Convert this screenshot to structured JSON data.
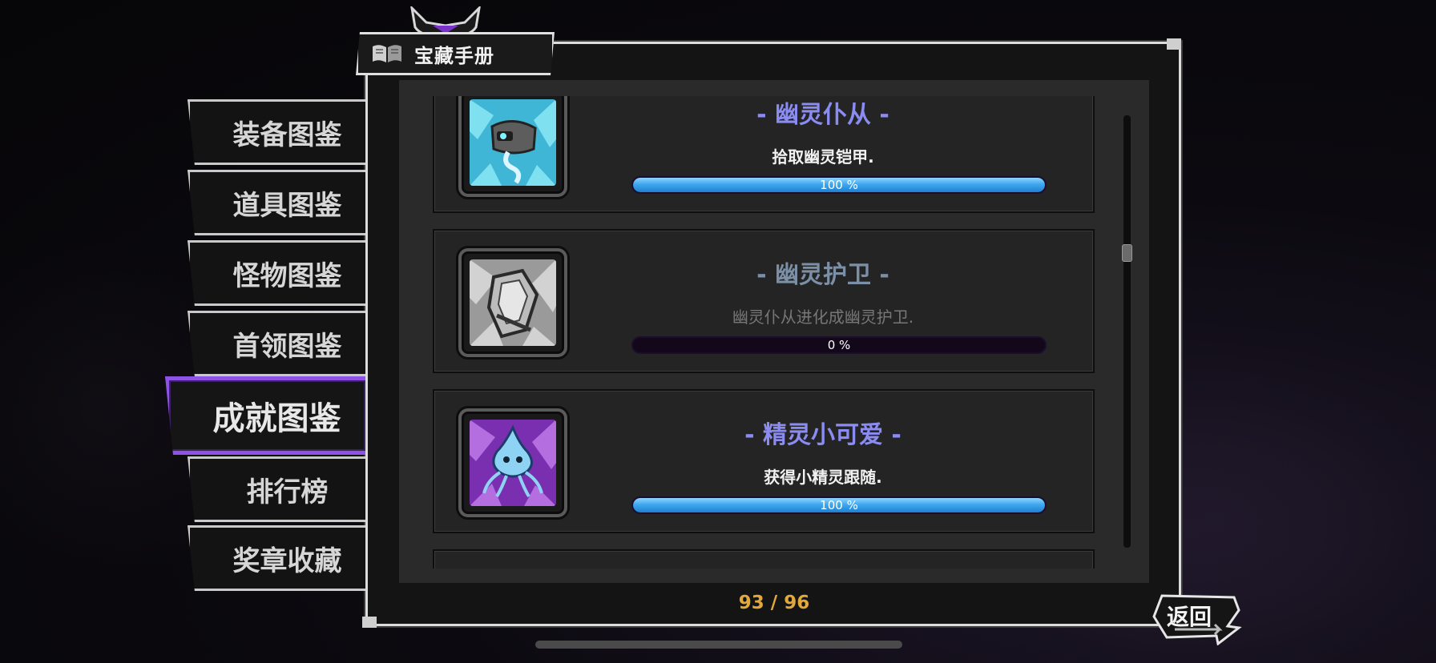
{
  "window": {
    "title": "宝藏手册"
  },
  "sidebar": {
    "tabs": [
      {
        "label": "装备图鉴"
      },
      {
        "label": "道具图鉴"
      },
      {
        "label": "怪物图鉴"
      },
      {
        "label": "首领图鉴"
      },
      {
        "label": "成就图鉴",
        "active": true
      },
      {
        "label": "排行榜"
      },
      {
        "label": "奖章收藏"
      }
    ]
  },
  "achievements": [
    {
      "name": "- 幽灵仆从 -",
      "desc": "拾取幽灵铠甲.",
      "progress_text": "100 %",
      "progress": 1.0,
      "icon": "ghost-armor-icon"
    },
    {
      "name": "- 幽灵护卫 -",
      "desc": "幽灵仆从进化成幽灵护卫.",
      "progress_text": "0 %",
      "progress": 0.0,
      "icon": "ghost-guard-icon"
    },
    {
      "name": "- 精灵小可爱 -",
      "desc": "获得小精灵跟随.",
      "progress_text": "100 %",
      "progress": 1.0,
      "icon": "wisp-spirit-icon"
    }
  ],
  "footer": {
    "page_count": "93 / 96",
    "back_label": "返回"
  },
  "colors": {
    "accent_purple": "#8e52e6",
    "progress_blue": "#3fa8ef",
    "count_gold": "#e2a83a",
    "title_done": "#8b8cf2",
    "title_locked": "#7b8fa6"
  },
  "scroll": {
    "position": 0.31
  }
}
